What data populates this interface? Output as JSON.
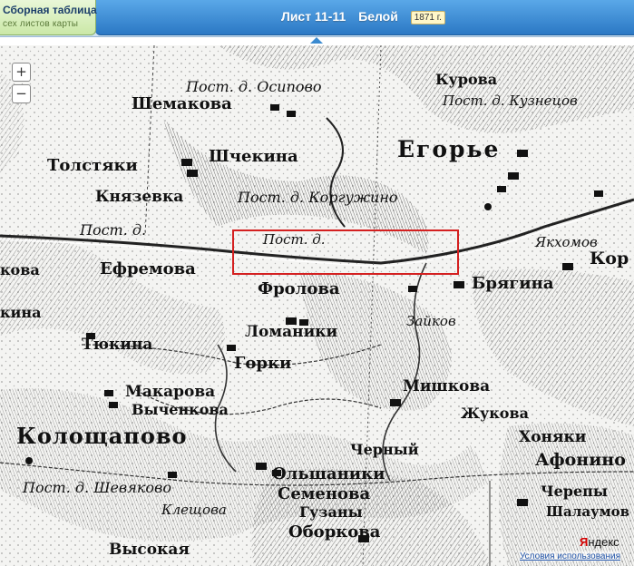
{
  "header": {
    "assembly_title": "Сборная таблица",
    "assembly_sub": "сех листов карты",
    "sheet": "Лист 11-11",
    "map_name": "Белой",
    "year": "1871 г."
  },
  "map": {
    "zoom_in": "+",
    "zoom_out": "−",
    "labels": {
      "vosipovo": "Пост. д. Осипово",
      "kurova": "Курова",
      "kuznetsov": "Пост. д. Кузнецов",
      "shemakova": "Шемакова",
      "shchekina": "Шчекина",
      "egore": "Егорье",
      "tolstyaki": "Толстяки",
      "knyazevka": "Князевка",
      "korguzhino": "Пост. д. Коргужино",
      "post_d": "Пост. д.",
      "post_d2": "Пост. д.",
      "yakhomov": "Якхомов",
      "efremova": "Ефремова",
      "frolova": "Фролова",
      "bryagina": "Брягина",
      "kor": "Кор",
      "zaikov": "Зайков",
      "lomaniki": "Ломаники",
      "tyukina": "Тюкина",
      "gorki": "Горки",
      "makarova": "Макарова",
      "mishkova": "Мишкова",
      "vychenkova": "Выченкова",
      "zhukova": "Жукова",
      "koloshchapovo": "Колощапово",
      "khonyaki": "Хоняки",
      "cherny": "Черный",
      "afonino": "Афонино",
      "olshaniki": "Ольшаники",
      "semenova": "Семенова",
      "cherepy": "Черепы",
      "shevyakovo": "Пост. д. Шевяково",
      "klestsova": "Клещова",
      "guzany": "Гузаны",
      "shalaumova": "Шалаумов",
      "okorkova": "Оборкова",
      "vysokaya": "Высокая",
      "kova": "кова",
      "kina": "кина"
    }
  },
  "footer": {
    "yandex_a": "Я",
    "yandex_b": "ндекс",
    "terms": "Условия использования"
  },
  "colors": {
    "accent": "#2b78c4",
    "selection": "#d42020",
    "assembly": "#cbe8a7"
  }
}
